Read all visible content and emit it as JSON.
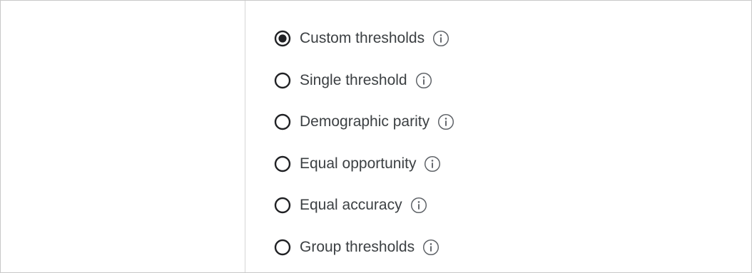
{
  "threshold_options": {
    "selected": "Custom thresholds",
    "items": [
      {
        "label": "Custom thresholds",
        "checked": true,
        "info_icon": "info-icon"
      },
      {
        "label": "Single threshold",
        "checked": false,
        "info_icon": "info-icon"
      },
      {
        "label": "Demographic parity",
        "checked": false,
        "info_icon": "info-icon"
      },
      {
        "label": "Equal opportunity",
        "checked": false,
        "info_icon": "info-icon"
      },
      {
        "label": "Equal accuracy",
        "checked": false,
        "info_icon": "info-icon"
      },
      {
        "label": "Group thresholds",
        "checked": false,
        "info_icon": "info-icon"
      }
    ]
  },
  "colors": {
    "radio_stroke": "#202124",
    "label_text": "#3c4043",
    "info_icon": "#5f6368",
    "divider": "#d6d6d6"
  }
}
